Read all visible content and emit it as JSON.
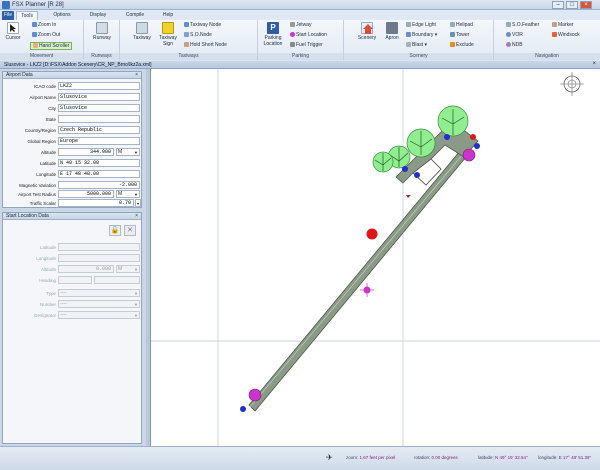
{
  "app": {
    "title": "FSX Planner [R 28]"
  },
  "tabs": [
    "File",
    "Tools",
    "Options",
    "Display",
    "Compile",
    "Help"
  ],
  "ribbon": {
    "movement": {
      "label": "Movement",
      "cursor": "Cursor",
      "zoom_in": "Zoom In",
      "zoom_out": "Zoom Out",
      "hand_scroller": "Hand Scroller"
    },
    "runways": {
      "label": "Runways",
      "runway": "Runway"
    },
    "taxiways": {
      "label": "Taxiways",
      "taxiway": "Taxiway",
      "taxiway_sign": "Taxiway Sign",
      "taxiway_node": "Taxiway Node",
      "s_o_node": "S.O.Node",
      "hold_short_node": "Hold Short Node"
    },
    "parking": {
      "label": "Parking",
      "parking_location": "Parking Location",
      "jetway": "Jetway",
      "start_location": "Start Location",
      "fuel_trigger": "Fuel Trigger"
    },
    "scenery": {
      "label": "Scenery",
      "scenery": "Scenery",
      "apron": "Apron",
      "edge_light": "Edge Light",
      "boundary": "Boundary",
      "blast": "Blast",
      "helipad": "Helipad",
      "tower": "Tower",
      "exclude": "Exclude"
    },
    "navigation": {
      "label": "Navigation",
      "s_o_feather": "S.O.Feather",
      "vor": "VOR",
      "ndb": "NDB",
      "marker": "Marker",
      "windsock": "Windsock"
    }
  },
  "map_bar": {
    "title": "Slusovice - LKZ2 [D:\\FSX\\Addon Scenery\\CR_NP_Brno\\lkz2a.xml]"
  },
  "airport_data": {
    "title": "Airport Data",
    "fields": [
      {
        "label": "ICAO code",
        "value": "LKZ2"
      },
      {
        "label": "Airport Name",
        "value": "Slusovice"
      },
      {
        "label": "City",
        "value": "Slusovice"
      },
      {
        "label": "State",
        "value": ""
      },
      {
        "label": "Country/Region",
        "value": "Czech Republic"
      },
      {
        "label": "Global Region",
        "value": "Europe"
      }
    ],
    "altitude": {
      "label": "Altitude",
      "value": "344.000",
      "unit": "M"
    },
    "latitude": {
      "label": "Latitude",
      "value": "N 49 15 32.00"
    },
    "longitude": {
      "label": "Longitude",
      "value": "E 17 48 48.00"
    },
    "magvar": {
      "label": "Magnetic Variation",
      "value": "-2.000"
    },
    "test_radius": {
      "label": "Airport Test Radius",
      "value": "5000.000",
      "unit": "M"
    },
    "traffic_scalar": {
      "label": "Traffic Scalar",
      "value": "0.70"
    }
  },
  "start_location": {
    "title": "Start Location Data",
    "latitude": "Latitude",
    "longitude": "Longitude",
    "altitude": {
      "label": "Altitude",
      "value": "0.000",
      "unit": "M"
    },
    "heading": "Heading",
    "type": {
      "label": "Type",
      "value": "----"
    },
    "number": {
      "label": "Number",
      "value": "----"
    },
    "designator": {
      "label": "Designator",
      "value": "----"
    }
  },
  "status": {
    "zoom_label": "zoom:",
    "zoom_value": "1.67 feet per pixel",
    "rotation_label": "rotation:",
    "rotation_value": "0.00 degrees",
    "latitude_label": "latitude:",
    "latitude_value": "N 49° 15' 32.54\"",
    "longitude_label": "longitude:",
    "longitude_value": "E 17° 48' 51.39\""
  },
  "colors": {
    "runway": "#8a9a86",
    "runway_edge": "#4d5a4a",
    "tree": "#90ee90",
    "node_blue": "#1f2fd0",
    "parking_magenta": "#cc33cc",
    "jetway_red": "#e01515"
  }
}
